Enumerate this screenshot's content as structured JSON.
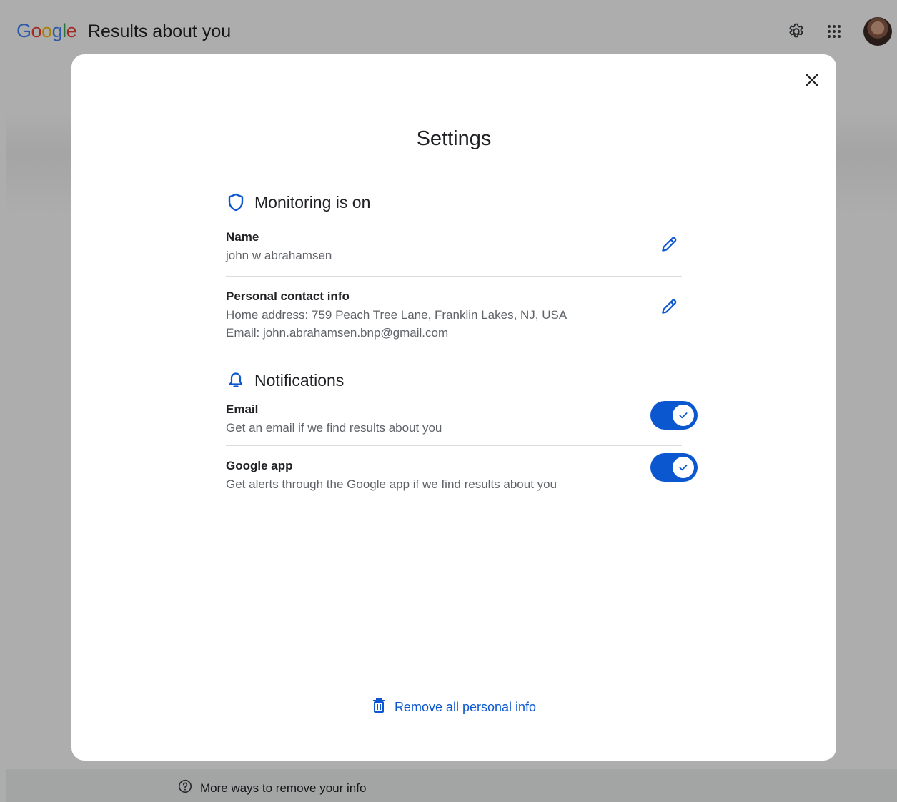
{
  "header": {
    "logo": {
      "g1": "G",
      "g2": "o",
      "g3": "o",
      "g4": "g",
      "g5": "l",
      "g6": "e"
    },
    "title": "Results about you",
    "icons": [
      "gear-icon",
      "apps-grid-icon",
      "avatar"
    ]
  },
  "footer": {
    "link_label": "More ways to remove your info",
    "icon": "help-circle-icon"
  },
  "dialog": {
    "title": "Settings",
    "close_icon": "close-icon",
    "monitoring": {
      "heading": "Monitoring is on",
      "icon": "shield-icon",
      "name": {
        "label": "Name",
        "value": "john w abrahamsen"
      },
      "contact": {
        "label": "Personal contact info",
        "address": "Home address: 759 Peach Tree Lane, Franklin Lakes, NJ, USA",
        "email": "Email: john.abrahamsen.bnp@gmail.com"
      }
    },
    "notifications": {
      "heading": "Notifications",
      "icon": "bell-icon",
      "email": {
        "label": "Email",
        "description": "Get an email if we find results about you",
        "enabled": true
      },
      "google_app": {
        "label": "Google app",
        "description": "Get alerts through the Google app if we find results about you",
        "enabled": true
      }
    },
    "remove_all": {
      "label": "Remove all personal info",
      "icon": "trash-icon"
    }
  },
  "colors": {
    "accent": "#0b57d0",
    "text_primary": "#202124",
    "text_secondary": "#5f6368",
    "scrim": "rgba(0,0,0,0.32)"
  }
}
